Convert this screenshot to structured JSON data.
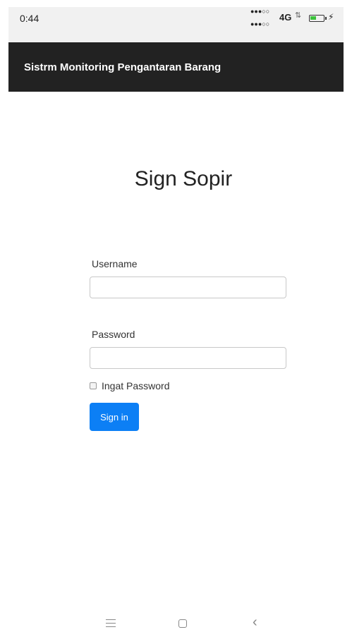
{
  "status_bar": {
    "time": "0:44",
    "signal_top": "●●●○○",
    "signal_bottom": "●●●○○",
    "network": "4G",
    "sync_icon": "sync-arrows-icon",
    "battery_level": 0.45,
    "battery_color": "#3cc23c",
    "charging_icon": "lightning-icon"
  },
  "navbar": {
    "title": "Sistrm Monitoring Pengantaran Barang",
    "background": "#222222"
  },
  "form": {
    "heading": "Sign Sopir",
    "username_label": "Username",
    "username_value": "",
    "password_label": "Password",
    "password_value": "",
    "remember_label": "Ingat Password",
    "remember_checked": false,
    "submit_label": "Sign in",
    "submit_color": "#0c7ff5"
  },
  "bottom_nav": {
    "menu_icon": "menu-icon",
    "home_icon": "home-square-icon",
    "back_icon": "back-chevron-icon",
    "back_glyph": "‹"
  }
}
